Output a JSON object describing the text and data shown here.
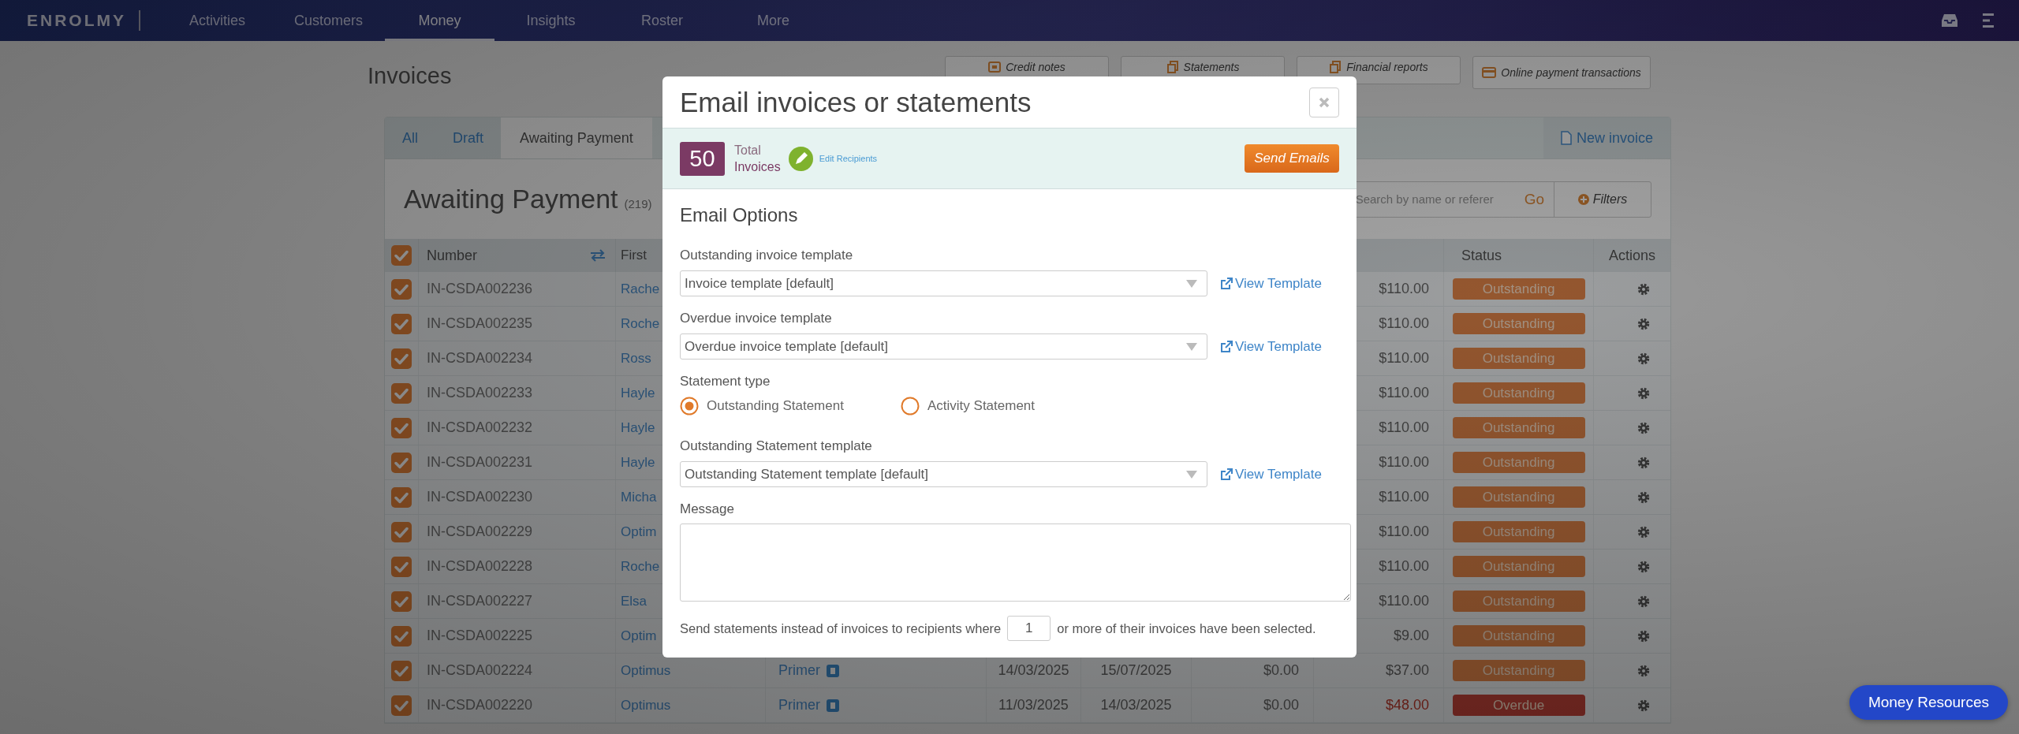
{
  "nav": {
    "logo": "ENROLMY",
    "items": [
      {
        "label": "Activities",
        "selected": false
      },
      {
        "label": "Customers",
        "selected": false
      },
      {
        "label": "Money",
        "selected": true
      },
      {
        "label": "Insights",
        "selected": false
      },
      {
        "label": "Roster",
        "selected": false
      },
      {
        "label": "More",
        "selected": false
      }
    ]
  },
  "page": {
    "title": "Invoices",
    "actions": [
      {
        "label": "Credit notes",
        "kind": "credit"
      },
      {
        "label": "Statements",
        "kind": "statements"
      },
      {
        "label": "Financial reports",
        "kind": "reports"
      },
      {
        "label": "Online payment transactions",
        "kind": "card"
      }
    ]
  },
  "tabs": [
    {
      "label": "All",
      "selected": false
    },
    {
      "label": "Draft",
      "selected": false
    },
    {
      "label": "Awaiting Payment",
      "selected": true
    }
  ],
  "new_invoice": "New invoice",
  "panel": {
    "heading": "Awaiting Payment",
    "count": "(219)",
    "search": {
      "placeholder": "Search by name or referer"
    },
    "go": "Go",
    "filters": "Filters"
  },
  "table": {
    "all_checked": true,
    "columns": [
      "Number",
      "First",
      "Status",
      "Actions"
    ],
    "rows": [
      {
        "checked": true,
        "number": "IN-CSDA002236",
        "first_name": "Rache",
        "amount": "$110.00",
        "status": "Outstanding",
        "kind": "outstanding"
      },
      {
        "checked": true,
        "number": "IN-CSDA002235",
        "first_name": "Roche",
        "amount": "$110.00",
        "status": "Outstanding",
        "kind": "outstanding"
      },
      {
        "checked": true,
        "number": "IN-CSDA002234",
        "first_name": "Ross",
        "amount": "$110.00",
        "status": "Outstanding",
        "kind": "outstanding"
      },
      {
        "checked": true,
        "number": "IN-CSDA002233",
        "first_name": "Hayle",
        "amount": "$110.00",
        "status": "Outstanding",
        "kind": "outstanding"
      },
      {
        "checked": true,
        "number": "IN-CSDA002232",
        "first_name": "Hayle",
        "amount": "$110.00",
        "status": "Outstanding",
        "kind": "outstanding"
      },
      {
        "checked": true,
        "number": "IN-CSDA002231",
        "first_name": "Hayle",
        "amount": "$110.00",
        "status": "Outstanding",
        "kind": "outstanding"
      },
      {
        "checked": true,
        "number": "IN-CSDA002230",
        "first_name": "Micha",
        "amount": "$110.00",
        "status": "Outstanding",
        "kind": "outstanding"
      },
      {
        "checked": true,
        "number": "IN-CSDA002229",
        "first_name": "Optim",
        "amount": "$110.00",
        "status": "Outstanding",
        "kind": "outstanding"
      },
      {
        "checked": true,
        "number": "IN-CSDA002228",
        "first_name": "Roche",
        "amount": "$110.00",
        "status": "Outstanding",
        "kind": "outstanding"
      },
      {
        "checked": true,
        "number": "IN-CSDA002227",
        "first_name": "Elsa",
        "amount": "$110.00",
        "status": "Outstanding",
        "kind": "outstanding"
      },
      {
        "checked": true,
        "number": "IN-CSDA002225",
        "first_name": "Optim",
        "amount": "$9.00",
        "status": "Outstanding",
        "kind": "outstanding"
      },
      {
        "checked": true,
        "number": "IN-CSDA002224",
        "first_name": "Optimus",
        "column_4": "Primer",
        "column_5": "14/03/2025",
        "column_6": "15/07/2025",
        "column_7": "$0.00",
        "amount": "$37.00",
        "status": "Outstanding",
        "kind": "outstanding"
      },
      {
        "checked": true,
        "number": "IN-CSDA002220",
        "first_name": "Optimus",
        "column_4": "Primer",
        "column_5": "11/03/2025",
        "column_6": "14/03/2025",
        "column_7": "$0.00",
        "amount": "$48.00",
        "status": "Overdue",
        "kind": "overdue"
      }
    ]
  },
  "modal": {
    "title": "Email invoices or statements",
    "count": "50",
    "count_label_1": "Total",
    "count_label_2": "Invoices",
    "edit_recipients": "Edit Recipients",
    "send": "Send Emails",
    "section": "Email Options",
    "fields": [
      {
        "kind": "select",
        "label": "Outstanding invoice template",
        "value": "Invoice template [default]",
        "link": "View Template"
      },
      {
        "kind": "select",
        "label": "Overdue invoice template",
        "value": "Overdue invoice template [default]",
        "link": "View Template"
      },
      {
        "kind": "radio",
        "label": "Statement type",
        "options": [
          {
            "label": "Outstanding Statement",
            "selected": true
          },
          {
            "label": "Activity Statement",
            "selected": false
          }
        ]
      },
      {
        "kind": "select",
        "label": "Outstanding Statement template",
        "value": "Outstanding Statement template [default]",
        "link": "View Template"
      },
      {
        "kind": "textarea",
        "label": "Message"
      }
    ],
    "threshold": {
      "before": "Send statements instead of invoices to recipients where",
      "value": "1",
      "after": "or more of their invoices have been selected."
    }
  },
  "help_button": "Money Resources"
}
